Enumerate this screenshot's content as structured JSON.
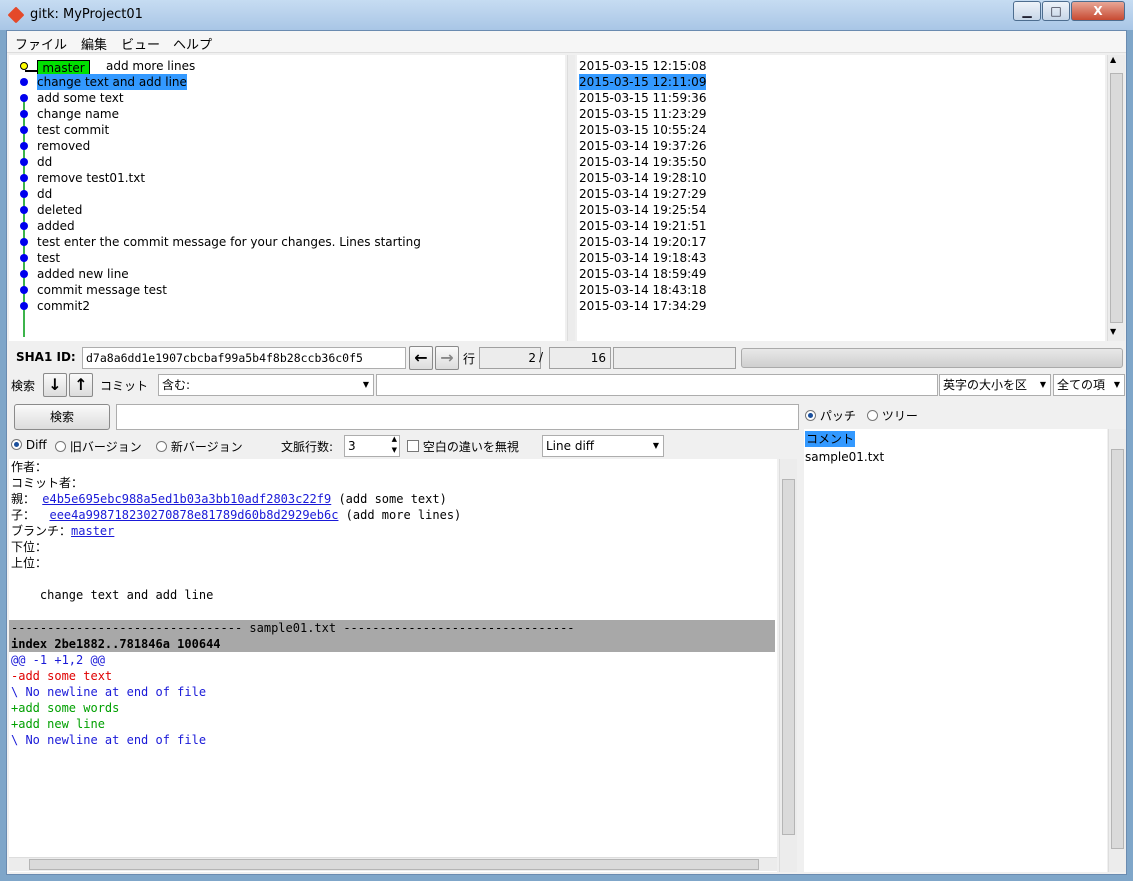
{
  "window": {
    "title": "gitk: MyProject01",
    "min": "▁",
    "max": "□",
    "close": "X"
  },
  "menu": [
    "ファイル",
    "編集",
    "ビュー",
    "ヘルプ"
  ],
  "branch_label": "master",
  "commits": [
    {
      "msg": "add more lines",
      "date": "2015-03-15 12:15:08"
    },
    {
      "msg": "change text and add line",
      "date": "2015-03-15 12:11:09"
    },
    {
      "msg": "add some text",
      "date": "2015-03-15 11:59:36"
    },
    {
      "msg": "change name",
      "date": "2015-03-15 11:23:29"
    },
    {
      "msg": "test commit",
      "date": "2015-03-15 10:55:24"
    },
    {
      "msg": "removed",
      "date": "2015-03-14 19:37:26"
    },
    {
      "msg": "dd",
      "date": "2015-03-14 19:35:50"
    },
    {
      "msg": "remove test01.txt",
      "date": "2015-03-14 19:28:10"
    },
    {
      "msg": "dd",
      "date": "2015-03-14 19:27:29"
    },
    {
      "msg": "deleted",
      "date": "2015-03-14 19:25:54"
    },
    {
      "msg": "added",
      "date": "2015-03-14 19:21:51"
    },
    {
      "msg": "test enter the commit message for your changes. Lines starting",
      "date": "2015-03-14 19:20:17"
    },
    {
      "msg": "test",
      "date": "2015-03-14 19:18:43"
    },
    {
      "msg": "added new line",
      "date": "2015-03-14 18:59:49"
    },
    {
      "msg": "commit message test",
      "date": "2015-03-14 18:43:18"
    },
    {
      "msg": "commit2",
      "date": "2015-03-14 17:34:29"
    }
  ],
  "sha": {
    "label": "SHA1 ID:",
    "value": "d7a8a6dd1e1907cbcbaf99a5b4f8b28ccb36c0f5",
    "back_icon": "left-arrow-icon",
    "fwd_icon": "right-arrow-icon",
    "row_label": "行",
    "row_current": "2",
    "row_sep": "/",
    "row_total": "16"
  },
  "search": {
    "label": "検索",
    "down_icon": "down-arrow-icon",
    "up_icon": "up-arrow-icon",
    "commit_label": "コミット",
    "mode": "含む:",
    "case": "英字の大小を区",
    "fields": "全ての項",
    "button": "検索"
  },
  "diff_opts": {
    "diff": "Diff",
    "old": "旧バージョン",
    "new": "新バージョン",
    "context_label": "文脈行数:",
    "context": "3",
    "ignore_ws": "空白の違いを無視",
    "diff_mode": "Line diff"
  },
  "file_opts": {
    "patch": "パッチ",
    "tree": "ツリー"
  },
  "files": [
    "コメント",
    "sample01.txt"
  ],
  "details": {
    "author": "作者：",
    "committer": "コミット者：",
    "parent_label": "親：",
    "parent_hash": "e4b5e695ebc988a5ed1b03a3bb10adf2803c22f9",
    "parent_msg": " (add some text)",
    "child_label": "子：",
    "child_hash": "eee4a998718230270878e81789d60b8d2929eb6c",
    "child_msg": " (add more lines)",
    "branch_label": "ブランチ：",
    "branch": "master",
    "precedes": "下位：",
    "follows": "上位：",
    "message": "    change text and add line"
  },
  "diff": {
    "file_header": "-------------------------------- sample01.txt --------------------------------",
    "index": "index 2be1882..781846a 100644",
    "hunk": "@@ -1 +1,2 @@",
    "lines": [
      {
        "t": "-add some text",
        "c": "#e00000"
      },
      {
        "t": "\\ No newline at end of file",
        "c": "#1a1ad8"
      },
      {
        "t": "+add some words",
        "c": "#00a000"
      },
      {
        "t": "+add new line",
        "c": "#00a000"
      },
      {
        "t": "\\ No newline at end of file",
        "c": "#1a1ad8"
      }
    ]
  }
}
